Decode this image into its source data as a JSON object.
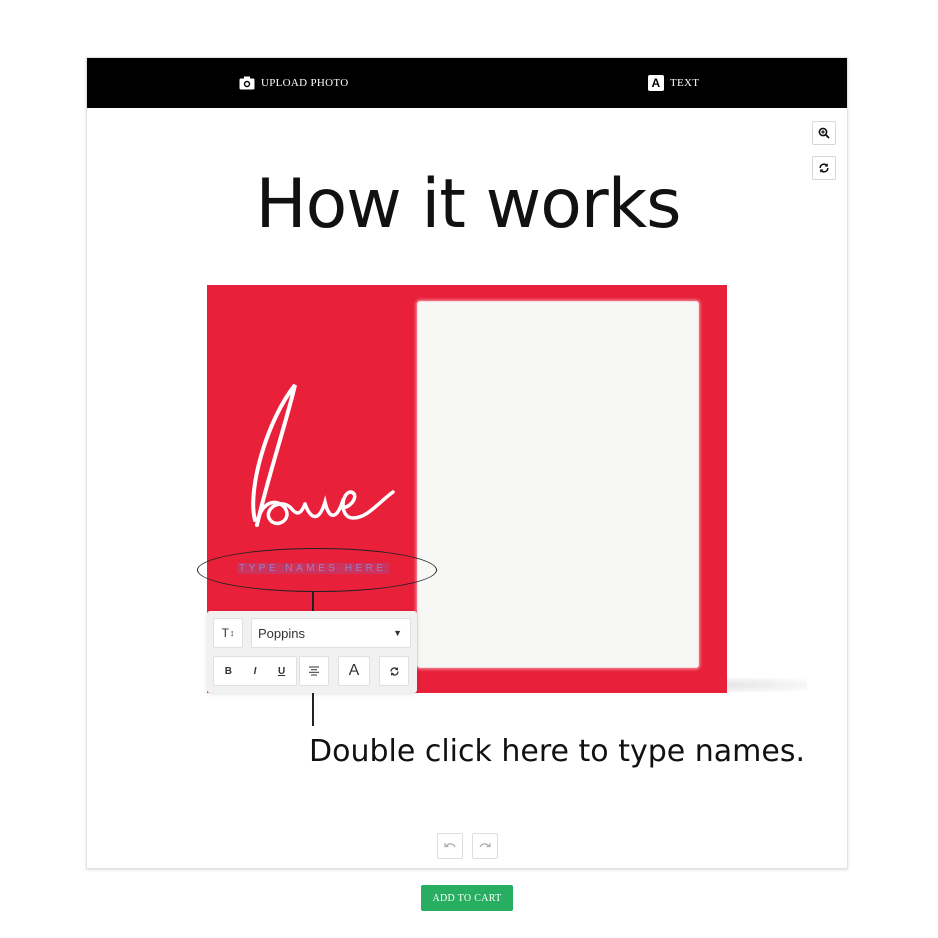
{
  "toolbar": {
    "upload_label": "UPLOAD PHOTO",
    "upload_icon": "camera-icon",
    "text_label": "TEXT",
    "text_icon": "text-icon",
    "text_badge_glyph": "A"
  },
  "side_controls": [
    "zoom-in-icon",
    "rotate-icon"
  ],
  "main": {
    "headline": "How it works",
    "card": {
      "background_color": "#e8203a",
      "script_text": "love",
      "names_placeholder": "TYPE NAMES HERE"
    },
    "text_toolbar": {
      "size_icon_label": "T",
      "font_value": "Poppins",
      "bold": "B",
      "italic": "I",
      "underline": "U",
      "color_glyph": "A"
    },
    "hint": "Double click here to type names."
  },
  "history": [
    "undo-icon",
    "redo-icon"
  ],
  "footer": {
    "add_to_cart_label": "ADD TO CART",
    "accent": "#27ae60"
  }
}
